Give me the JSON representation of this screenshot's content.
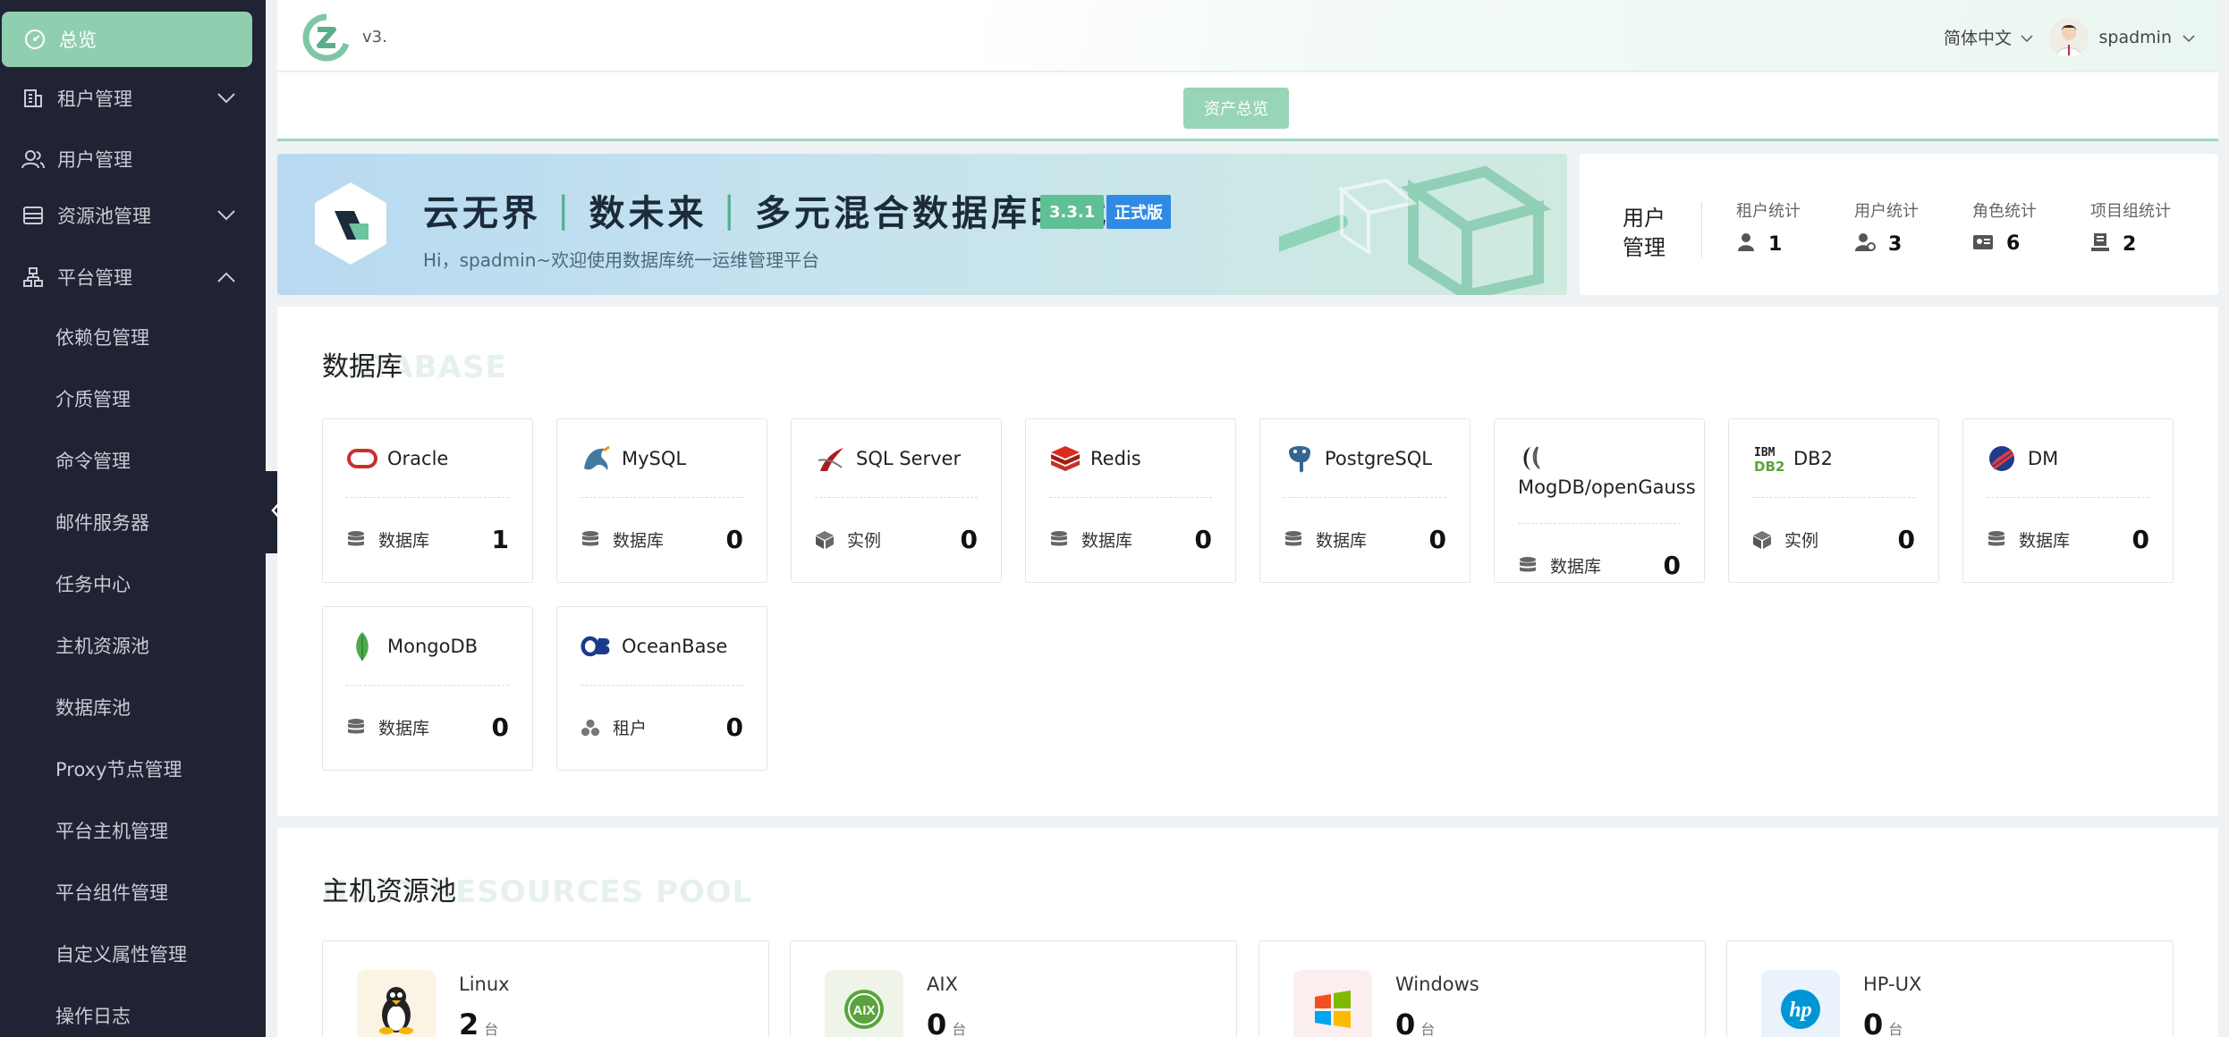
{
  "header": {
    "version": "v3.",
    "language": "简体中文",
    "username": "spadmin"
  },
  "sidebar": {
    "items": [
      {
        "label": "总览",
        "icon": "dashboard-icon"
      },
      {
        "label": "租户管理",
        "icon": "building-icon"
      },
      {
        "label": "用户管理",
        "icon": "users-icon"
      },
      {
        "label": "资源池管理",
        "icon": "storage-icon"
      },
      {
        "label": "平台管理",
        "icon": "org-chart-icon"
      }
    ],
    "subitems": [
      "依赖包管理",
      "介质管理",
      "命令管理",
      "邮件服务器",
      "任务中心",
      "主机资源池",
      "数据库池",
      "Proxy节点管理",
      "平台主机管理",
      "平台组件管理",
      "自定义属性管理",
      "操作日志"
    ]
  },
  "asset_bar": {
    "button_label": "资产总览"
  },
  "banner": {
    "title_parts": [
      "云无界",
      "数未来",
      "多元混合数据库时代"
    ],
    "version_badge": "3.3.1",
    "release_badge": "正式版",
    "subtitle": "Hi，spadmin~欢迎使用数据库统一运维管理平台"
  },
  "stats": {
    "title": "用户管理",
    "items": [
      {
        "label": "租户统计",
        "value": "1",
        "icon": "tenant-icon"
      },
      {
        "label": "用户统计",
        "value": "3",
        "icon": "user-stat-icon"
      },
      {
        "label": "角色统计",
        "value": "6",
        "icon": "role-card-icon"
      },
      {
        "label": "项目组统计",
        "value": "2",
        "icon": "project-icon"
      }
    ]
  },
  "database_panel": {
    "title": "数据库",
    "ghost_title": "DATABASE",
    "cards": [
      {
        "name": "Oracle",
        "icon": "oracle-icon",
        "metric_label": "数据库",
        "metric_icon": "database-icon",
        "value": "1"
      },
      {
        "name": "MySQL",
        "icon": "mysql-icon",
        "metric_label": "数据库",
        "metric_icon": "database-icon",
        "value": "0"
      },
      {
        "name": "SQL Server",
        "icon": "sqlserver-icon",
        "metric_label": "实例",
        "metric_icon": "cube-icon",
        "value": "0"
      },
      {
        "name": "Redis",
        "icon": "redis-icon",
        "metric_label": "数据库",
        "metric_icon": "database-icon",
        "value": "0"
      },
      {
        "name": "PostgreSQL",
        "icon": "postgresql-icon",
        "metric_label": "数据库",
        "metric_icon": "database-icon",
        "value": "0"
      },
      {
        "name": "MogDB/openGauss",
        "icon": "mogdb-icon",
        "metric_label": "数据库",
        "metric_icon": "database-icon",
        "value": "0"
      },
      {
        "name": "DB2",
        "icon": "db2-icon",
        "metric_label": "实例",
        "metric_icon": "cube-icon",
        "value": "0"
      },
      {
        "name": "DM",
        "icon": "dm-icon",
        "metric_label": "数据库",
        "metric_icon": "database-icon",
        "value": "0"
      },
      {
        "name": "MongoDB",
        "icon": "mongodb-icon",
        "metric_label": "数据库",
        "metric_icon": "database-icon",
        "value": "0"
      },
      {
        "name": "OceanBase",
        "icon": "oceanbase-icon",
        "metric_label": "租户",
        "metric_icon": "tenant-cluster-icon",
        "value": "0"
      }
    ]
  },
  "host_panel": {
    "title": "主机资源池",
    "ghost_title": "HOST RESOURCES POOL",
    "cards": [
      {
        "name": "Linux",
        "icon": "linux-icon",
        "count": "2",
        "unit": "台"
      },
      {
        "name": "AIX",
        "icon": "aix-icon",
        "count": "0",
        "unit": "台"
      },
      {
        "name": "Windows",
        "icon": "windows-icon",
        "count": "0",
        "unit": "台"
      },
      {
        "name": "HP-UX",
        "icon": "hp-icon",
        "count": "0",
        "unit": "台"
      }
    ]
  },
  "colors": {
    "accent": "#8fcfaf",
    "sidebar_bg": "#1f2333",
    "badge_blue": "#2f8ae6"
  }
}
